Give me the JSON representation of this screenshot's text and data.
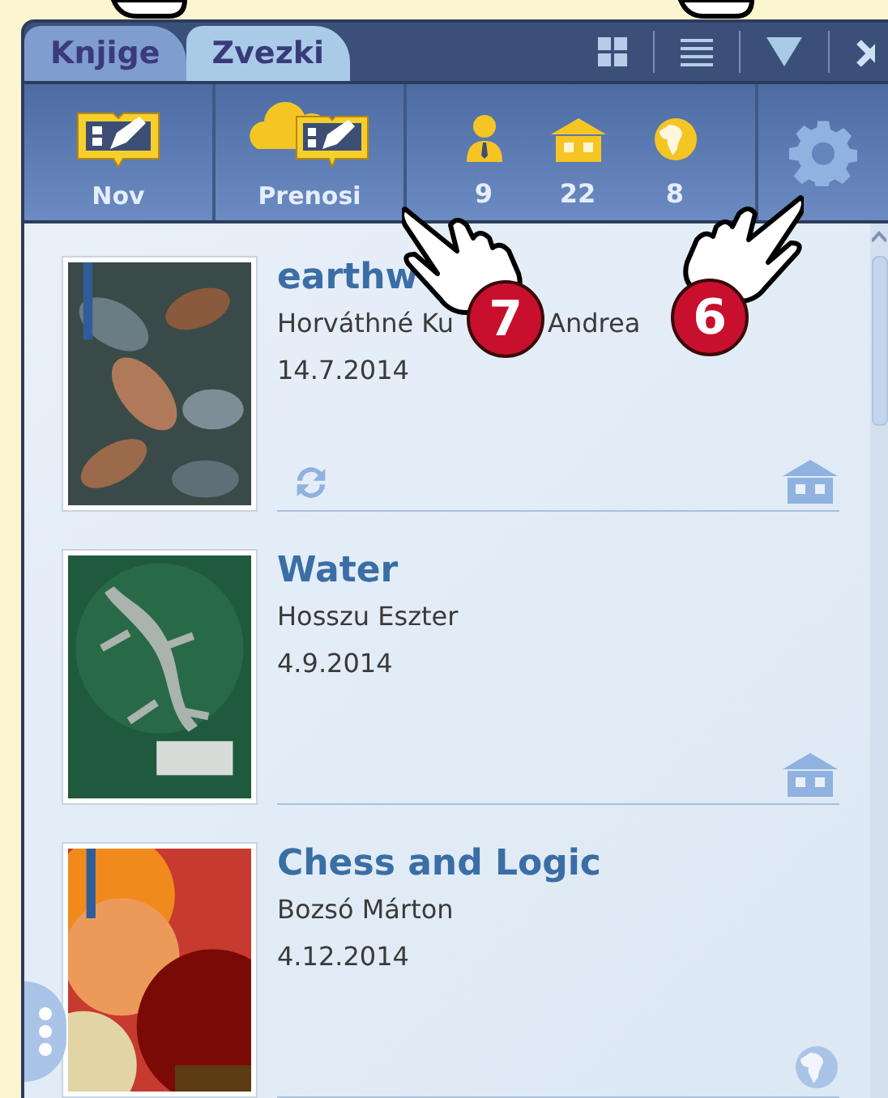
{
  "tabs": [
    {
      "label": "Knjige",
      "selected": false
    },
    {
      "label": "Zvezki",
      "selected": true
    }
  ],
  "toolbar": {
    "buttons": [
      {
        "label": "Nov",
        "kind": "new"
      },
      {
        "label": "Prenosi",
        "kind": "downloads"
      }
    ],
    "counters": [
      {
        "kind": "person",
        "count": "9"
      },
      {
        "kind": "house",
        "count": "22"
      },
      {
        "kind": "globe",
        "count": "8"
      }
    ]
  },
  "books": [
    {
      "title": "earthw",
      "author_parts": [
        "Horváthné Ku",
        "Andrea"
      ],
      "date": "14.7.2014",
      "sync_icon": true,
      "location_icon": {
        "kind": "house"
      }
    },
    {
      "title": "Water",
      "author_parts": [
        "Hosszu Eszter"
      ],
      "date": "4.9.2014",
      "sync_icon": false,
      "location_icon": {
        "kind": "house"
      }
    },
    {
      "title": "Chess and Logic",
      "author_parts": [
        "Bozsó Márton"
      ],
      "date": "4.12.2014",
      "sync_icon": false,
      "location_icon": {
        "kind": "globe"
      }
    }
  ],
  "callouts": [
    {
      "number": "7"
    },
    {
      "number": "6"
    }
  ]
}
